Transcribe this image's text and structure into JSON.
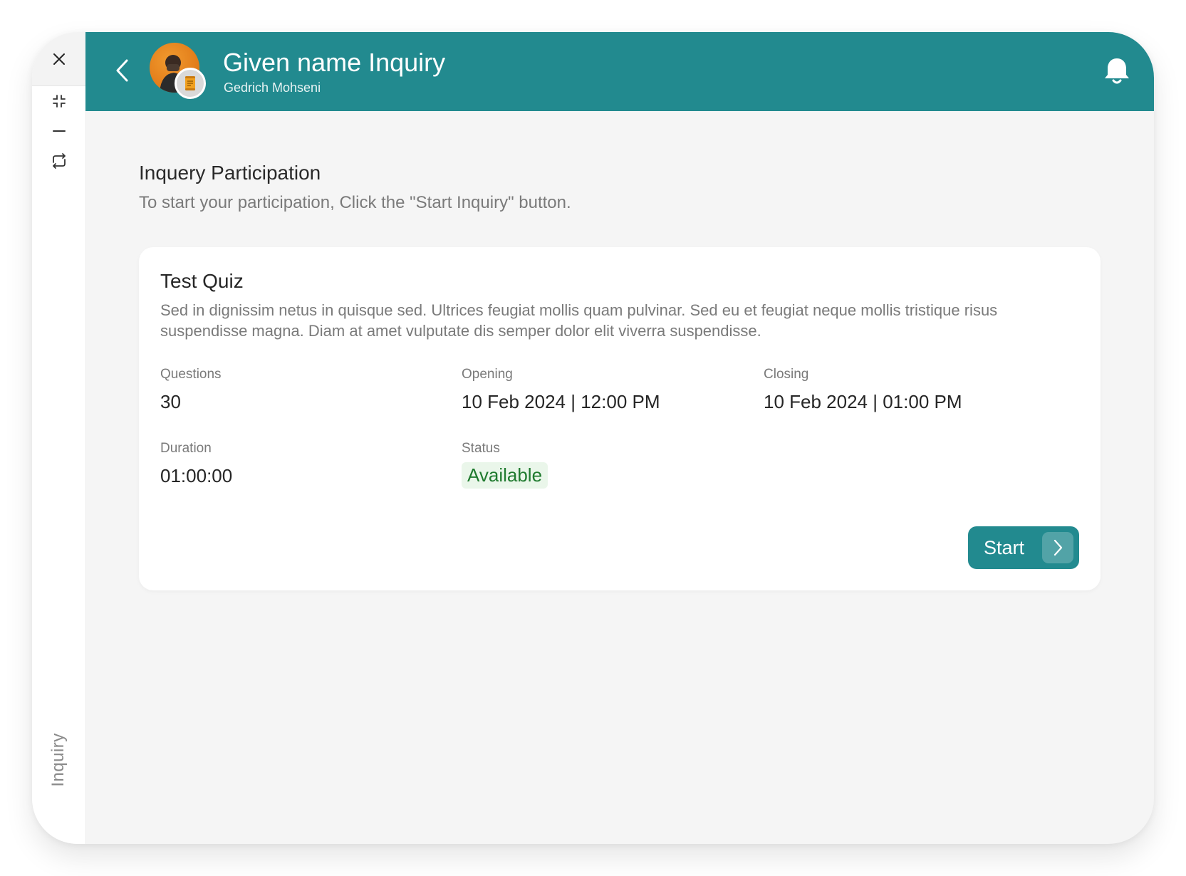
{
  "rail": {
    "label": "Inquiry",
    "icons": [
      "close-icon",
      "minimize-screen-icon",
      "minus-icon",
      "refresh-icon"
    ]
  },
  "header": {
    "title": "Given name Inquiry",
    "subtitle": "Gedrich Mohseni",
    "background_color": "#228a8f"
  },
  "page": {
    "title": "Inquery Participation",
    "subtitle": "To start your participation, Click the \"Start Inquiry\" button."
  },
  "quiz": {
    "title": "Test Quiz",
    "description": "Sed in dignissim netus in quisque sed. Ultrices feugiat mollis quam pulvinar. Sed eu et feugiat neque mollis tristique risus suspendisse magna. Diam at amet vulputate dis semper dolor elit viverra suspendisse.",
    "questions_label": "Questions",
    "questions_value": "30",
    "opening_label": "Opening",
    "opening_value": "10 Feb 2024 | 12:00 PM",
    "closing_label": "Closing",
    "closing_value": "10 Feb 2024 | 01:00 PM",
    "duration_label": "Duration",
    "duration_value": "01:00:00",
    "status_label": "Status",
    "status_value": "Available",
    "status_color": "#1f7a2e",
    "start_label": "Start"
  }
}
